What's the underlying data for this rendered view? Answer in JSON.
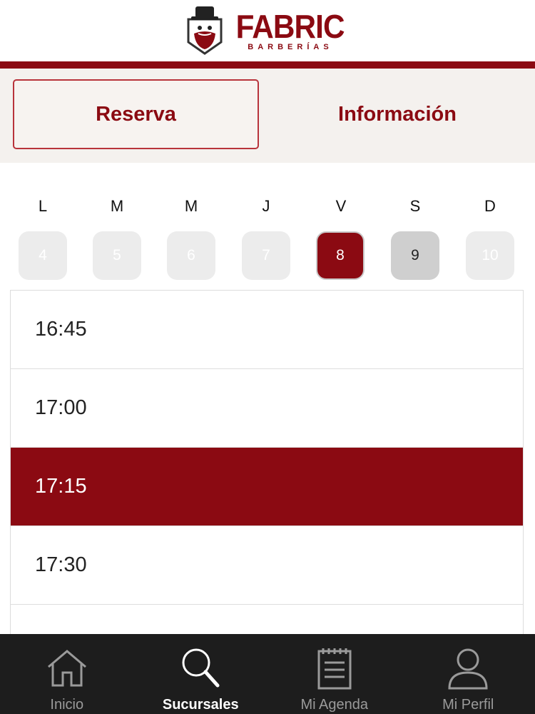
{
  "brand": {
    "name": "FABRIC",
    "tagline": "BARBERÍAS",
    "color": "#8b0a12"
  },
  "tabs": [
    {
      "label": "Reserva",
      "active": true
    },
    {
      "label": "Información",
      "active": false
    }
  ],
  "calendar": {
    "days": [
      {
        "letter": "L",
        "number": "4",
        "state": "disabled"
      },
      {
        "letter": "M",
        "number": "5",
        "state": "disabled"
      },
      {
        "letter": "M",
        "number": "6",
        "state": "disabled"
      },
      {
        "letter": "J",
        "number": "7",
        "state": "disabled"
      },
      {
        "letter": "V",
        "number": "8",
        "state": "selected"
      },
      {
        "letter": "S",
        "number": "9",
        "state": "available"
      },
      {
        "letter": "D",
        "number": "10",
        "state": "disabled"
      }
    ]
  },
  "time_slots": [
    {
      "time": "16:45",
      "selected": false
    },
    {
      "time": "17:00",
      "selected": false
    },
    {
      "time": "17:15",
      "selected": true
    },
    {
      "time": "17:30",
      "selected": false
    },
    {
      "time": "",
      "selected": false
    }
  ],
  "bottom_nav": [
    {
      "label": "Inicio",
      "icon": "home-icon",
      "active": false
    },
    {
      "label": "Sucursales",
      "icon": "search-icon",
      "active": true
    },
    {
      "label": "Mi Agenda",
      "icon": "notepad-icon",
      "active": false
    },
    {
      "label": "Mi Perfil",
      "icon": "user-icon",
      "active": false
    }
  ]
}
